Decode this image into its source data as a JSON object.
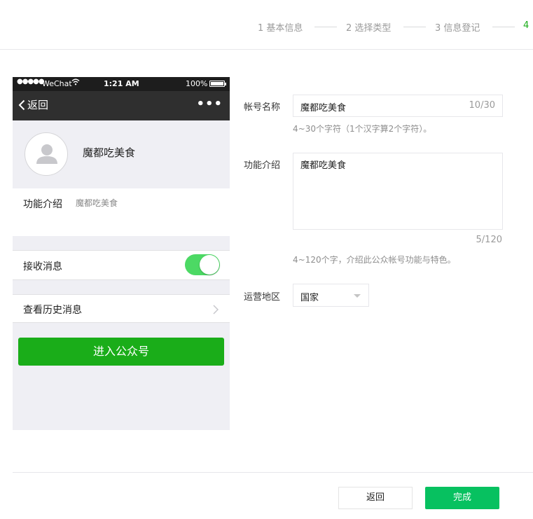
{
  "steps": [
    {
      "label": "1 基本信息"
    },
    {
      "label": "2 选择类型"
    },
    {
      "label": "3 信息登记"
    },
    {
      "label": "4"
    }
  ],
  "preview": {
    "status_bar": {
      "carrier": "WeChat",
      "time": "1:21 AM",
      "battery": "100%"
    },
    "nav": {
      "back_label": "返回",
      "more_label": "•••"
    },
    "account_name": "魔都吃美食",
    "intro_label": "功能介绍",
    "intro_value": "魔都吃美食",
    "receive_label": "接收消息",
    "receive_on": true,
    "history_label": "查看历史消息",
    "enter_label": "进入公众号"
  },
  "form": {
    "name": {
      "label": "帐号名称",
      "value": "魔都吃美食",
      "counter": "10/30",
      "hint": "4~30个字符（1个汉字算2个字符）。"
    },
    "intro": {
      "label": "功能介绍",
      "value": "魔都吃美食",
      "counter": "5/120",
      "hint": "4~120个字，介绍此公众帐号功能与特色。"
    },
    "region": {
      "label": "运营地区",
      "value": "国家"
    }
  },
  "footer": {
    "back_label": "返回",
    "done_label": "完成"
  },
  "colors": {
    "accent": "#1aad19",
    "done": "#07c160",
    "toggle": "#4cd964",
    "nav": "#2f2f2f"
  }
}
